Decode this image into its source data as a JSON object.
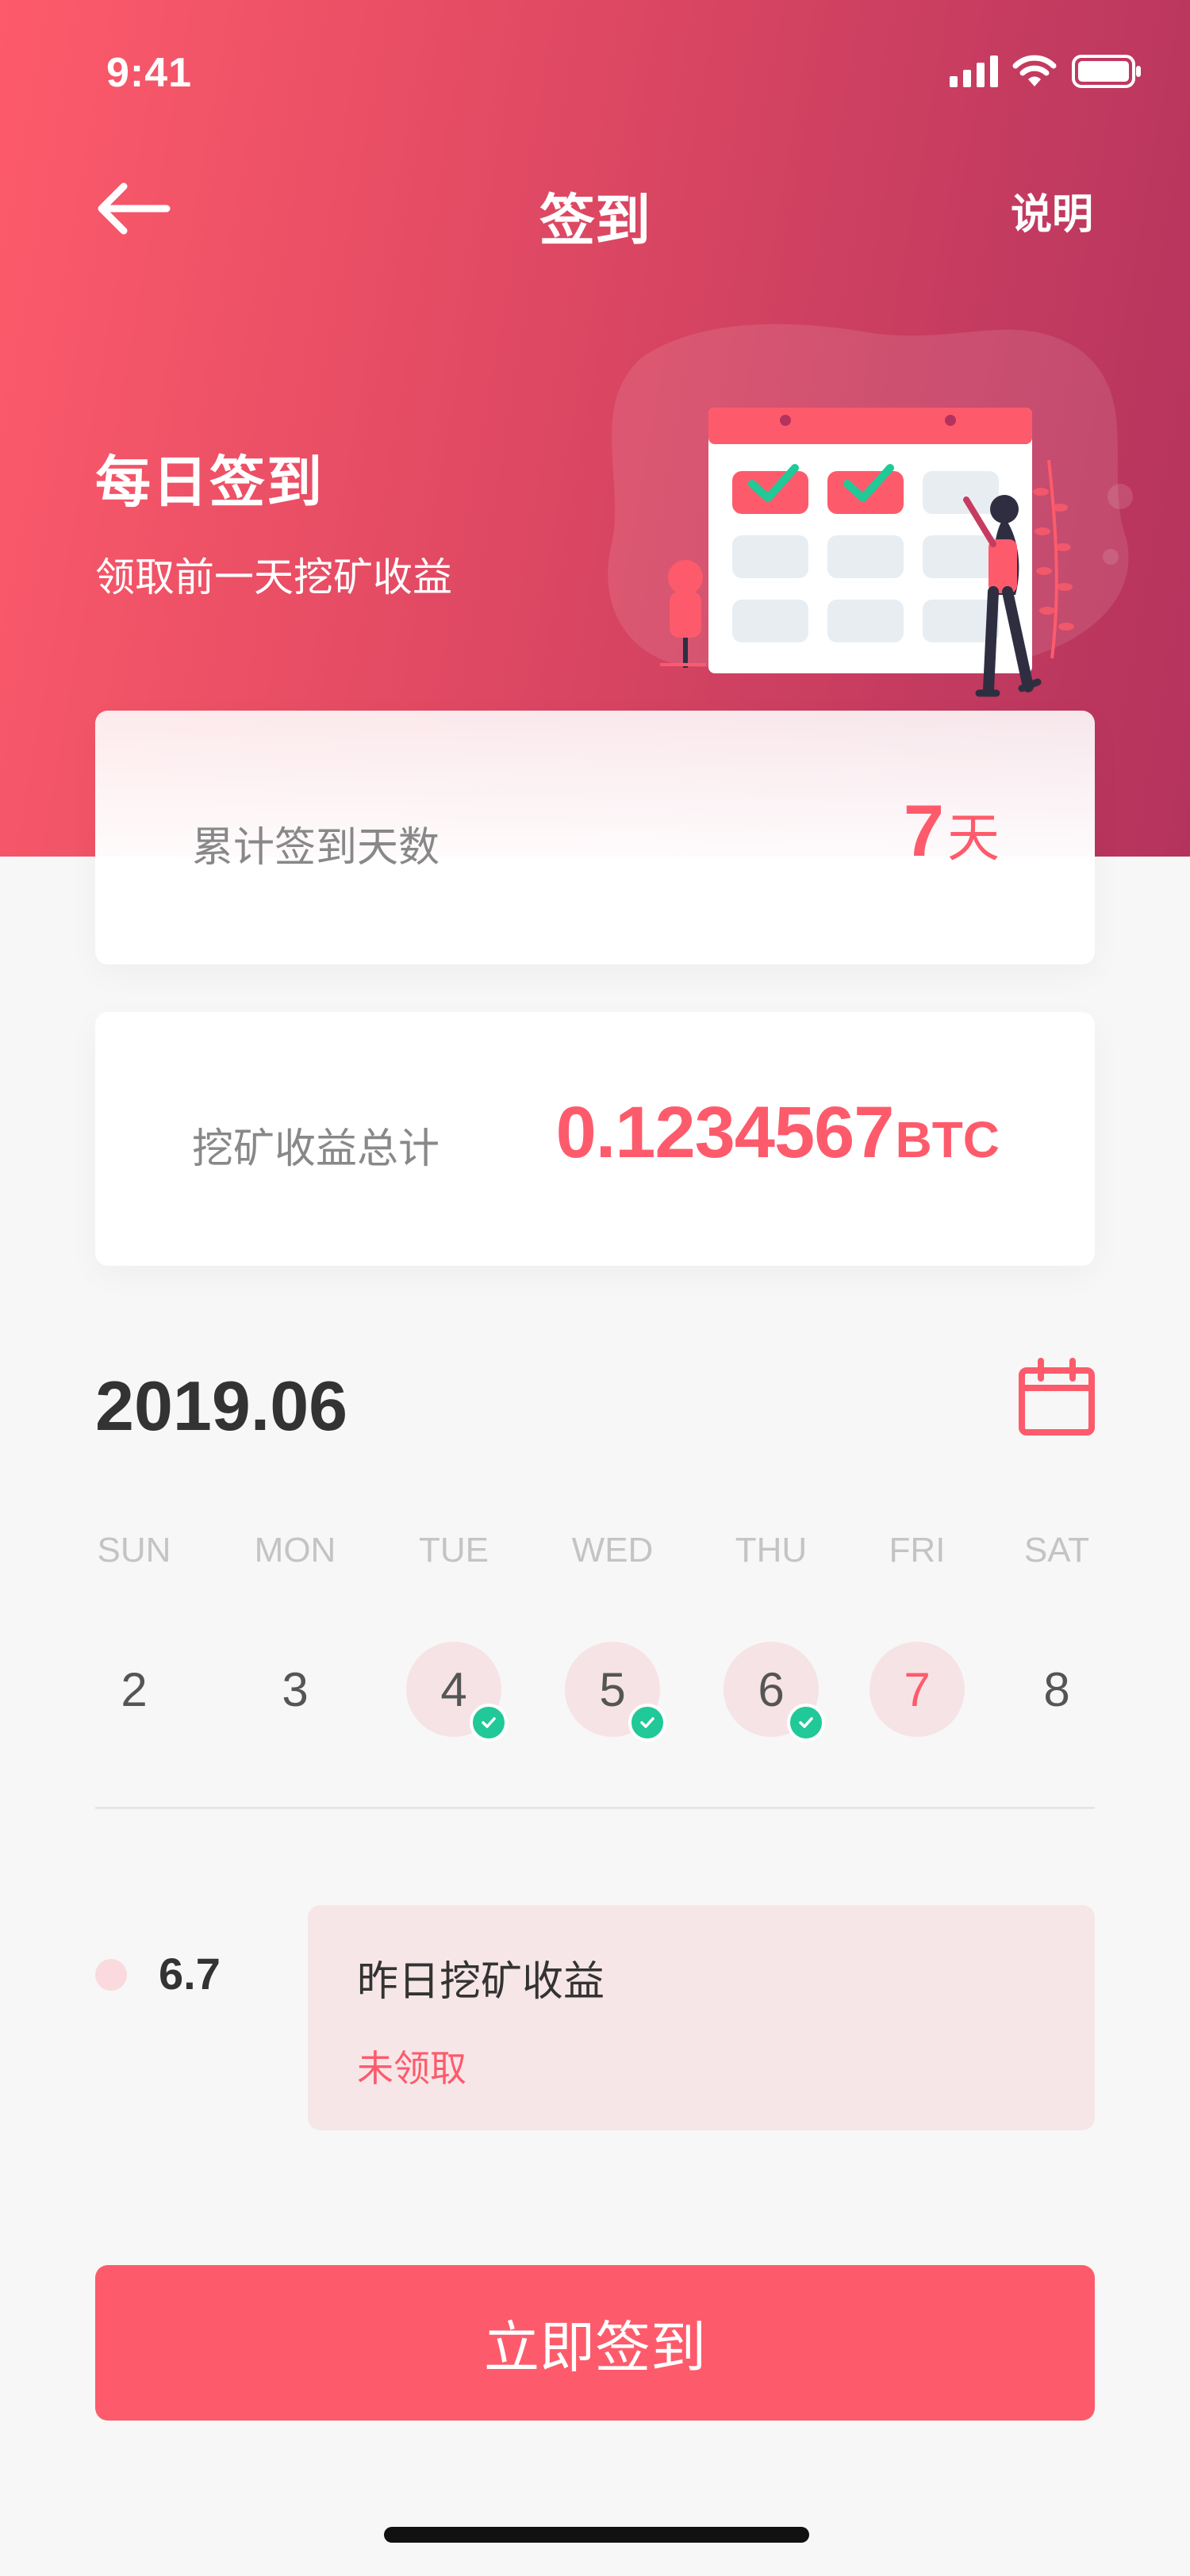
{
  "status_bar": {
    "time": "9:41"
  },
  "nav": {
    "title": "签到",
    "help": "说明"
  },
  "hero": {
    "title": "每日签到",
    "subtitle": "领取前一天挖矿收益"
  },
  "days_card": {
    "label": "累计签到天数",
    "value": "7",
    "unit": "天"
  },
  "btc_card": {
    "label": "挖矿收益总计",
    "value": "0.1234567",
    "unit": "BTC"
  },
  "calendar": {
    "month": "2019.06",
    "weekdays": [
      "SUN",
      "MON",
      "TUE",
      "WED",
      "THU",
      "FRI",
      "SAT"
    ],
    "days": [
      {
        "day": "2",
        "state": "normal"
      },
      {
        "day": "3",
        "state": "normal"
      },
      {
        "day": "4",
        "state": "signed"
      },
      {
        "day": "5",
        "state": "signed"
      },
      {
        "day": "6",
        "state": "signed"
      },
      {
        "day": "7",
        "state": "today"
      },
      {
        "day": "8",
        "state": "normal"
      }
    ]
  },
  "record": {
    "date": "6.7",
    "title": "昨日挖矿收益",
    "status": "未领取"
  },
  "signin_button": "立即签到",
  "colors": {
    "accent": "#fd5b6b",
    "check": "#20c997",
    "gradient_end": "#b4335d"
  }
}
